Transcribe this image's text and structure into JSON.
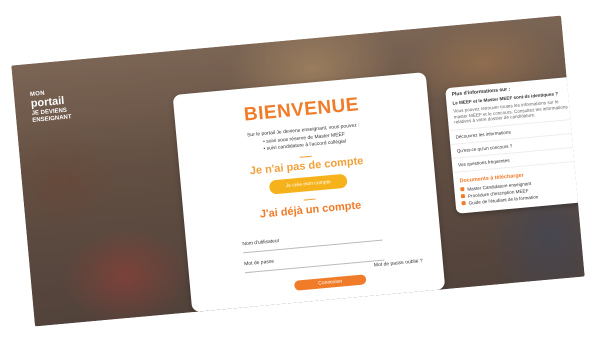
{
  "logo": {
    "line1": "MON",
    "line2": "portail",
    "line3": "JE DEVIENS",
    "line4": "ENSEIGNANT"
  },
  "card": {
    "title": "BIENVENUE",
    "intro": "Sur le portail Je deviens enseignant, vous pouvez :",
    "bullets": [
      "• suivi sous réserve de Master MEEF",
      "• suivi candidature à l'accord collégial"
    ],
    "no_account_title": "Je n'ai pas de compte",
    "create_button": "Je crée mon compte",
    "has_account_title": "J'ai déjà un compte",
    "email_label": "Nom d'utilisateur",
    "password_label": "Mot de passe",
    "forgot_label": "Mot de passe oublié ?",
    "login_button": "Connexion"
  },
  "panel": {
    "header": "Plus d'informations sur :",
    "question": "Le MEEF et le Master MEEF sont-ils identiques ?",
    "body": "Vous pouvez retrouver toutes les informations sur le master MEEF et le concours. Consultez les informations relatives à votre dossier de candidature.",
    "sub_link": "Découvrez les informations",
    "item2": "Qu'est-ce qu'un concours ?",
    "item3": "Vos questions fréquentes",
    "downloads_title": "Documents à télécharger",
    "downloads": [
      "Master Candidature enseignant",
      "Procédure d'inscription MEEF",
      "Guide de l'étudiant de la formation"
    ]
  }
}
